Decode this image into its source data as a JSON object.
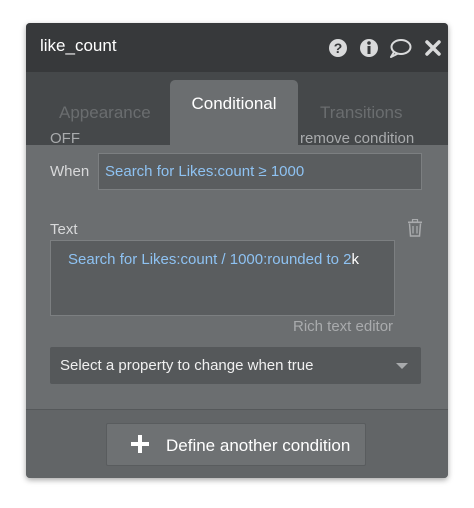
{
  "panel": {
    "title": "like_count",
    "header_icons": [
      "help-icon",
      "info-icon",
      "comment-icon",
      "close-icon"
    ]
  },
  "tabs": [
    {
      "label": "Appearance",
      "active": false
    },
    {
      "label": "Conditional",
      "active": true
    },
    {
      "label": "Transitions",
      "active": false
    }
  ],
  "condition": {
    "status": "OFF",
    "remove_label": "remove condition",
    "when_label": "When",
    "when_expression": "Search for Likes:count ≥ 1000"
  },
  "text_property": {
    "label": "Text",
    "expression": "Search for Likes:count / 1000:rounded to 2",
    "suffix": "k",
    "rich_text_label": "Rich text editor"
  },
  "property_select": {
    "value": "Select a property to change when true"
  },
  "footer": {
    "define_button_label": "Define another condition"
  },
  "colors": {
    "panel_bg": "#6b6e70",
    "titlebar_bg": "#37393b",
    "tabbar_bg": "#45484a",
    "expression_blue": "#8ec2f2"
  }
}
